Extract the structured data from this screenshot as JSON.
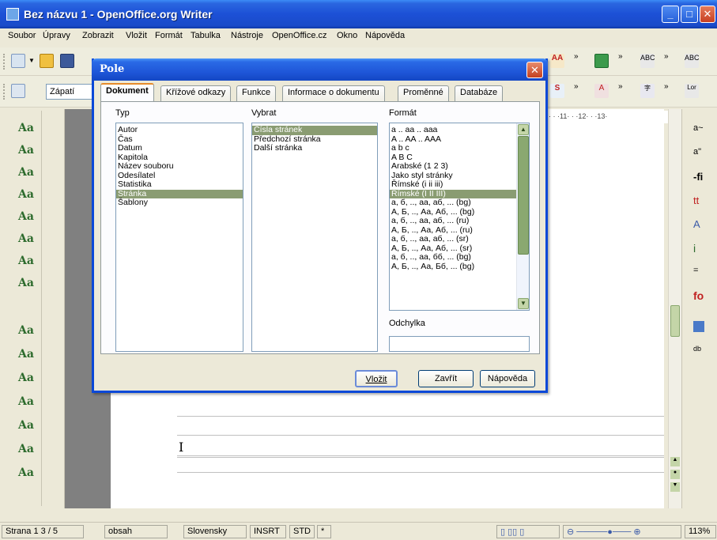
{
  "window": {
    "title": "Bez názvu 1 - OpenOffice.org Writer"
  },
  "menu": [
    "Soubor",
    "Úpravy",
    "Zobrazit",
    "Vložit",
    "Formát",
    "Tabulka",
    "Nástroje",
    "OpenOffice.cz",
    "Okno",
    "Nápověda"
  ],
  "toolbar": {
    "style_value": "Zápatí"
  },
  "dialog": {
    "title": "Pole",
    "tabs": [
      "Dokument",
      "Křížové odkazy",
      "Funkce",
      "Informace o dokumentu",
      "Proměnné",
      "Databáze"
    ],
    "active_tab": "Dokument",
    "typ_label": "Typ",
    "typ_items": [
      "Autor",
      "Čas",
      "Datum",
      "Kapitola",
      "Název souboru",
      "Odesílatel",
      "Statistika",
      "Stránka",
      "Šablony"
    ],
    "typ_selected": "Stránka",
    "vybrat_label": "Vybrat",
    "vybrat_items": [
      "Čísla stránek",
      "Předchozí stránka",
      "Další stránka"
    ],
    "vybrat_selected": "Čísla stránek",
    "format_label": "Formát",
    "format_items": [
      "a .. aa .. aaa",
      "A .. AA .. AAA",
      "a b c",
      "A B C",
      "Arabské (1 2 3)",
      "Jako styl stránky",
      "Římské (i ii iii)",
      "Římské (I II III)",
      "а, б, .., аа, аб, ... (bg)",
      "А, Б, .., Аа, Аб, ... (bg)",
      "а, б, .., аа, аб, ... (ru)",
      "А, Б, .., Аа, Аб, ... (ru)",
      "а, б, .., аа, аб, ... (sr)",
      "А, Б, .., Аа, Аб, ... (sr)",
      "а, б, .., аа, бб, ... (bg)",
      "А, Б, .., Аа, Бб, ... (bg)"
    ],
    "format_selected": "Římské (I II III)",
    "odchylka_label": "Odchylka",
    "odchylka_value": "",
    "buttons": {
      "insert": "Vložit",
      "close": "Zavřít",
      "help": "Nápověda"
    }
  },
  "ruler": {
    "ticks": "· · ·11· · ·12· · ·13·"
  },
  "statusbar": {
    "page": "Strana 1   3 / 5",
    "style": "obsah",
    "language": "Slovensky",
    "insert": "INSRT",
    "selection": "STD",
    "modified": "*",
    "zoom": "113%"
  }
}
